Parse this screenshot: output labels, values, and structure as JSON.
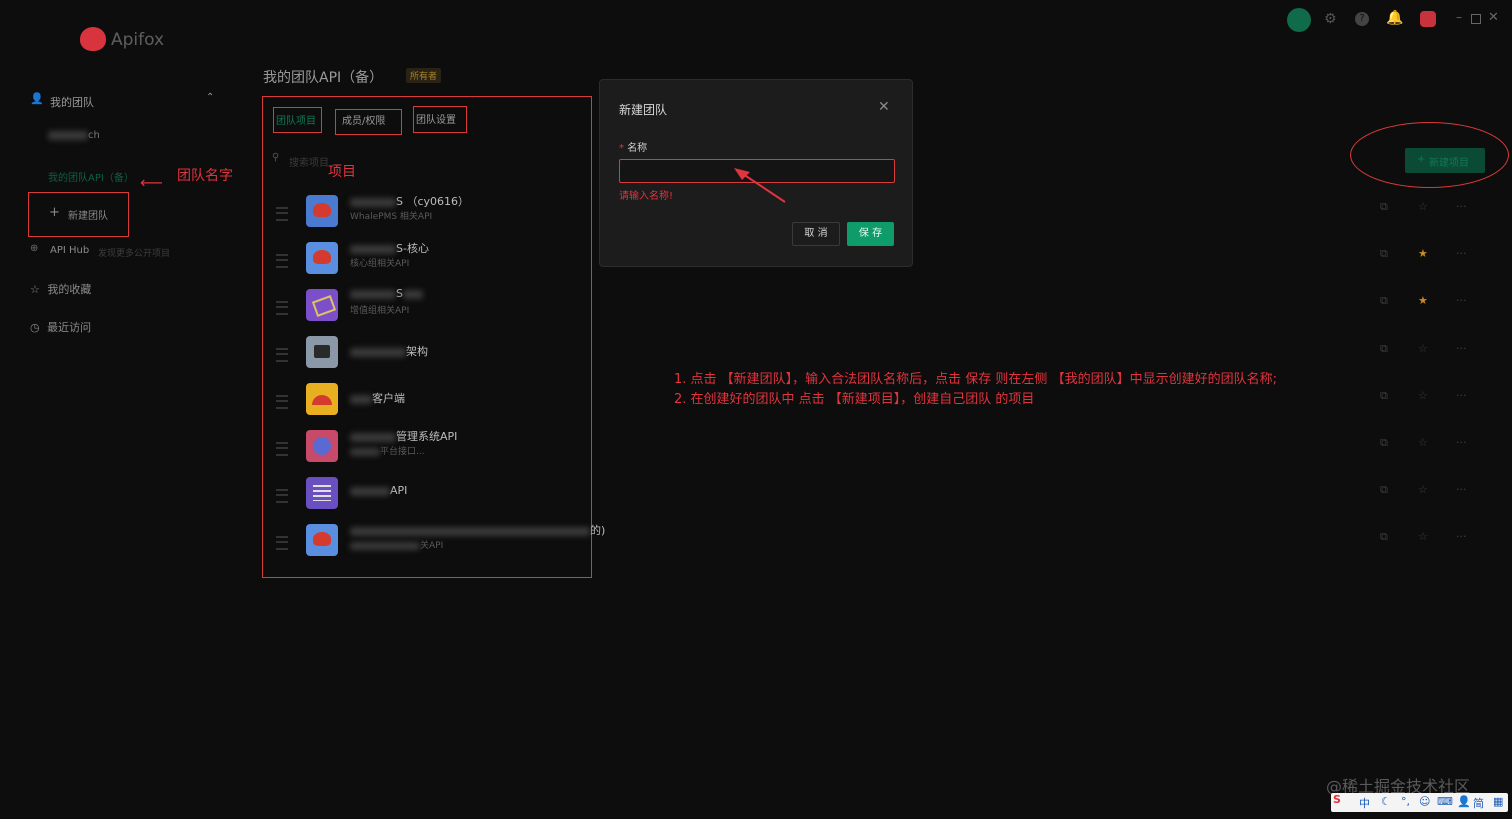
{
  "app": {
    "name": "Apifox"
  },
  "sidebar": {
    "my_team": "我的团队",
    "team1": "ch",
    "team2": "我的团队API（备）",
    "new_team": "新建团队",
    "api_hub": "API Hub",
    "api_hub_sub": "发现更多公开项目",
    "favorites": "我的收藏",
    "recent": "最近访问"
  },
  "header": {
    "title": "我的团队API（备）",
    "role": "所有者"
  },
  "tabs": {
    "projects": "团队项目",
    "members": "成员/权限",
    "settings": "团队设置"
  },
  "search": {
    "placeholder": "搜索项目"
  },
  "projects": [
    {
      "title": "S （cy0616）",
      "sub": "WhalePMS 相关API",
      "color": "#4a7bd0"
    },
    {
      "title": "S-核心",
      "sub": "核心组相关API",
      "color": "#5a8ee0"
    },
    {
      "title": "S",
      "sub": "增值组相关API",
      "color": "#7b4fc9"
    },
    {
      "title": "架构",
      "sub": "",
      "color": "#8a98a8"
    },
    {
      "title": "客户端",
      "sub": "",
      "color": "#e8b020"
    },
    {
      "title": "管理系统API",
      "sub": "平台接口...",
      "color": "#c84a6a"
    },
    {
      "title": "API",
      "sub": "",
      "color": "#6a4fc0"
    },
    {
      "title": "的)",
      "sub": "关API",
      "color": "#5a8ee0"
    }
  ],
  "annotations": {
    "team_name": "团队名字",
    "project": "项目",
    "line1": "1. 点击 【新建团队】，输入合法团队名称后，点击 保存 则在左侧 【我的团队】中显示创建好的团队名称;",
    "line2": "2. 在创建好的团队中  点击 【新建项目】，创建自己团队 的项目"
  },
  "modal": {
    "title": "新建团队",
    "name_label": "名称",
    "error": "请输入名称!",
    "cancel": "取 消",
    "save": "保 存"
  },
  "new_project": "新建项目",
  "watermark": "@稀土掘金技术社区",
  "ime": [
    "中",
    "简"
  ],
  "colors": {
    "accent": "#0f9b6a",
    "error": "#e0343e",
    "annotation": "#e0343e"
  }
}
